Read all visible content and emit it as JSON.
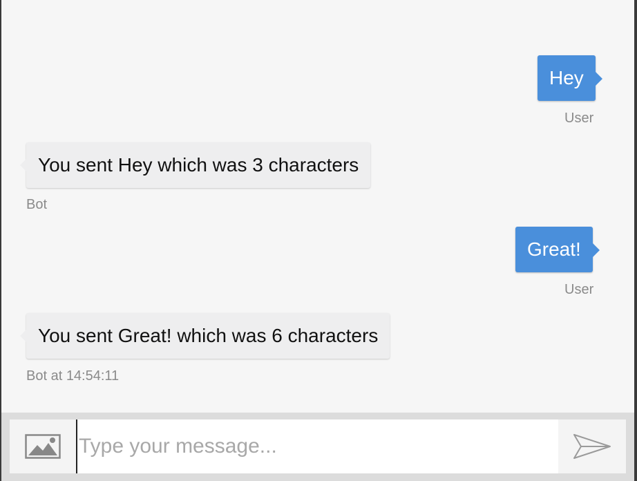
{
  "conversation": {
    "messages": [
      {
        "from": "user",
        "text": "Hey",
        "meta": "User"
      },
      {
        "from": "bot",
        "text": "You sent Hey which was 3 characters",
        "meta": "Bot"
      },
      {
        "from": "user",
        "text": "Great!",
        "meta": "User"
      },
      {
        "from": "bot",
        "text": "You sent Great! which was 6 characters",
        "meta": "Bot at 14:54:11"
      }
    ]
  },
  "composer": {
    "placeholder": "Type your message...",
    "image_icon": "image-icon",
    "send_icon": "send-icon"
  },
  "colors": {
    "user_bubble": "#4a8fdb",
    "bot_bubble": "#eeeeef",
    "background": "#f6f6f6"
  }
}
